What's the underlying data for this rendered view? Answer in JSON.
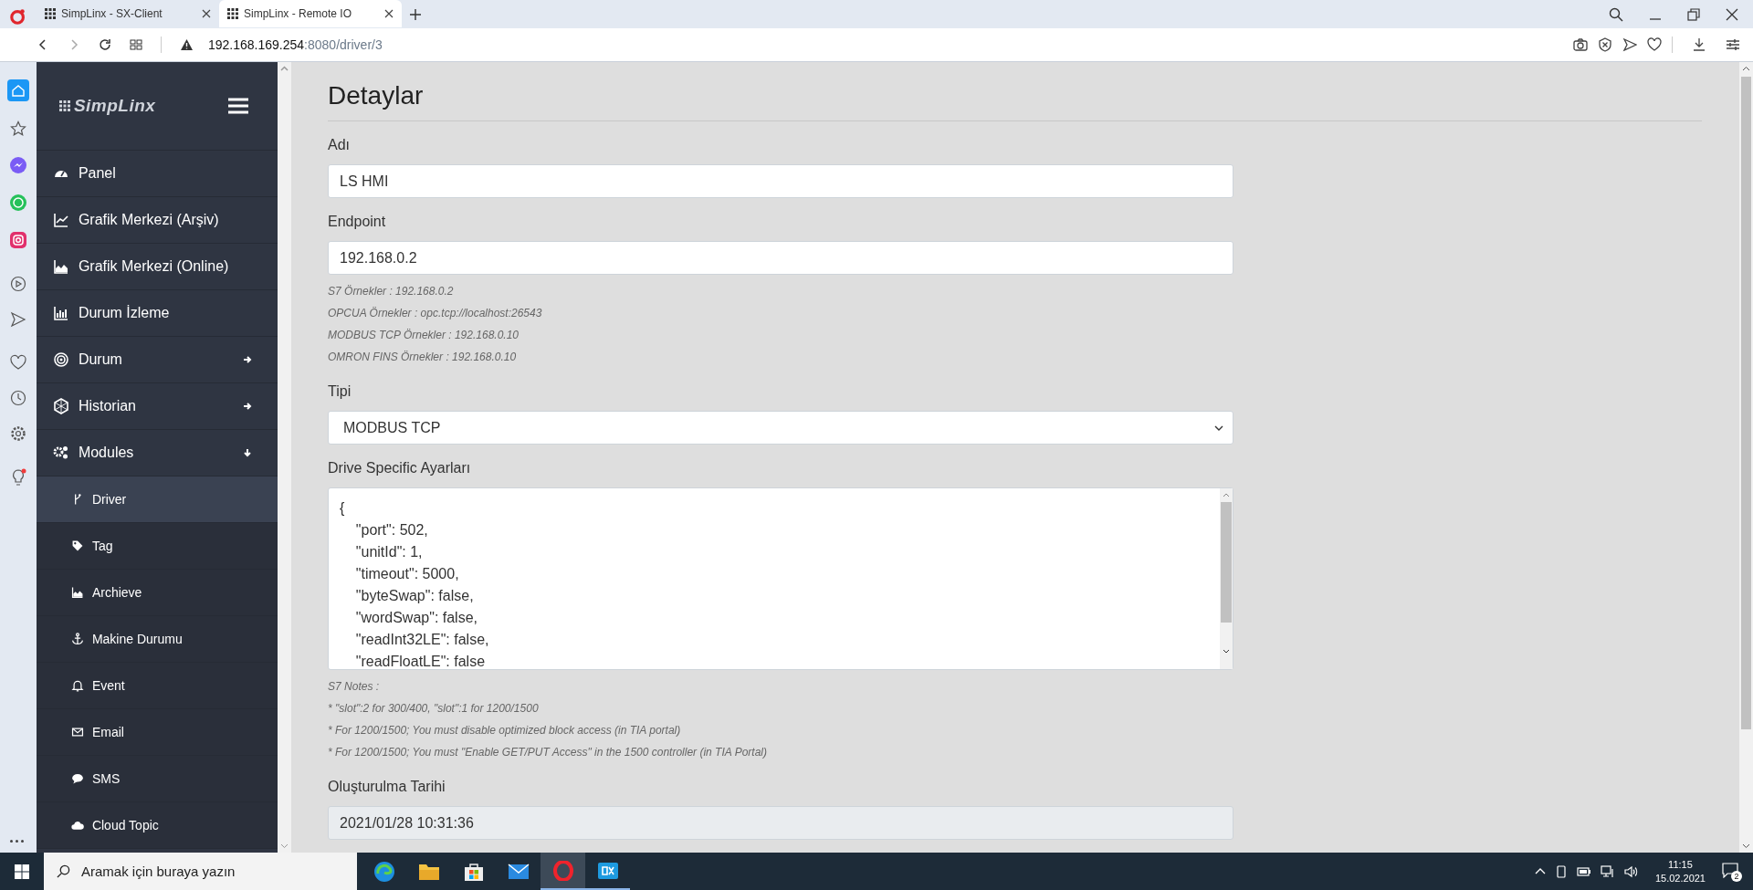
{
  "browser_tabs": [
    {
      "title": "SimpLinx - SX-Client",
      "selected": false
    },
    {
      "title": "SimpLinx - Remote IO",
      "selected": true
    }
  ],
  "address_bar": {
    "host": "192.168.169.254",
    "path": ":8080/driver/3"
  },
  "sidebar": {
    "logo": "SimpLinx",
    "items": [
      {
        "label": "Panel",
        "selected": false
      },
      {
        "label": "Grafik Merkezi (Arşiv)",
        "selected": false
      },
      {
        "label": "Grafik Merkezi (Online)",
        "selected": false
      },
      {
        "label": "Durum İzleme",
        "selected": false
      },
      {
        "label": "Durum",
        "selected": false,
        "expanded": false
      },
      {
        "label": "Historian",
        "selected": false,
        "expanded": false
      },
      {
        "label": "Modules",
        "selected": false,
        "expanded": true,
        "children": [
          {
            "label": "Driver",
            "selected": true
          },
          {
            "label": "Tag",
            "selected": false
          },
          {
            "label": "Archieve",
            "selected": false
          },
          {
            "label": "Makine Durumu",
            "selected": false
          },
          {
            "label": "Event",
            "selected": false
          },
          {
            "label": "Email",
            "selected": false
          },
          {
            "label": "SMS",
            "selected": false
          },
          {
            "label": "Cloud Topic",
            "selected": false
          }
        ]
      }
    ]
  },
  "page": {
    "title": "Detaylar",
    "fields": [
      {
        "kind": "input",
        "label": "Adı",
        "value": "LS HMI",
        "disabled": false
      },
      {
        "kind": "input",
        "label": "Endpoint",
        "value": "192.168.0.2",
        "disabled": false,
        "hints": [
          "S7 Örnekler : 192.168.0.2",
          "OPCUA Örnekler : opc.tcp://localhost:26543",
          "MODBUS TCP Örnekler : 192.168.0.10",
          "OMRON FINS Örnekler : 192.168.0.10"
        ]
      },
      {
        "kind": "select",
        "label": "Tipi",
        "value": "MODBUS TCP",
        "disabled": false
      },
      {
        "kind": "textarea",
        "label": "Drive Specific Ayarları",
        "lines": [
          "{",
          "    \"port\": 502,",
          "    \"unitId\": 1,",
          "    \"timeout\": 5000,",
          "    \"byteSwap\": false,",
          "    \"wordSwap\": false,",
          "    \"readInt32LE\": false,",
          "    \"readFloatLE\": false"
        ],
        "disabled": false,
        "hints": [
          "S7 Notes :",
          "* \"slot\":2 for 300/400, \"slot\":1 for 1200/1500",
          "* For 1200/1500; You must disable optimized block access (in TIA portal)",
          "* For 1200/1500; You must \"Enable GET/PUT Access\" in the 1500 controller (in TIA Portal)"
        ]
      },
      {
        "kind": "input",
        "label": "Oluşturulma Tarihi",
        "value": "2021/01/28 10:31:36",
        "disabled": true
      }
    ]
  },
  "taskbar": {
    "search_placeholder": "Aramak için buraya yazın",
    "time": "11:15",
    "date": "15.02.2021",
    "notifications": "2"
  }
}
